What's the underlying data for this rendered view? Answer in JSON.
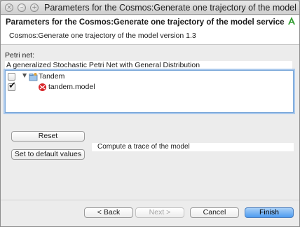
{
  "window": {
    "title": "Parameters for the Cosmos:Generate one trajectory of the model service"
  },
  "banner": {
    "title": "Parameters for the Cosmos:Generate one trajectory of the model service",
    "subtitle": "Cosmos:Generate one trajectory of the model version 1.3"
  },
  "petri": {
    "label": "Petri net:",
    "description": "A generalized Stochastic Petri Net with General Distribution",
    "tree": [
      {
        "label": "Tandem",
        "checked": false
      },
      {
        "label": "tandem.model",
        "checked": true
      }
    ]
  },
  "params": {
    "reset_label": "Reset",
    "default_label": "Set to default values",
    "info": "Compute a trace of the model"
  },
  "footer": {
    "back_label": "< Back",
    "next_label": "Next >",
    "cancel_label": "Cancel",
    "finish_label": "Finish"
  },
  "icons": {
    "close": "close-icon",
    "minimize": "minimize-icon",
    "zoom": "zoom-icon",
    "folder": "folder-icon",
    "model": "model-icon",
    "logo": "app-logo-icon"
  },
  "colors": {
    "default_button": "#4f9cf0",
    "selection_border": "#7aa7d9"
  }
}
